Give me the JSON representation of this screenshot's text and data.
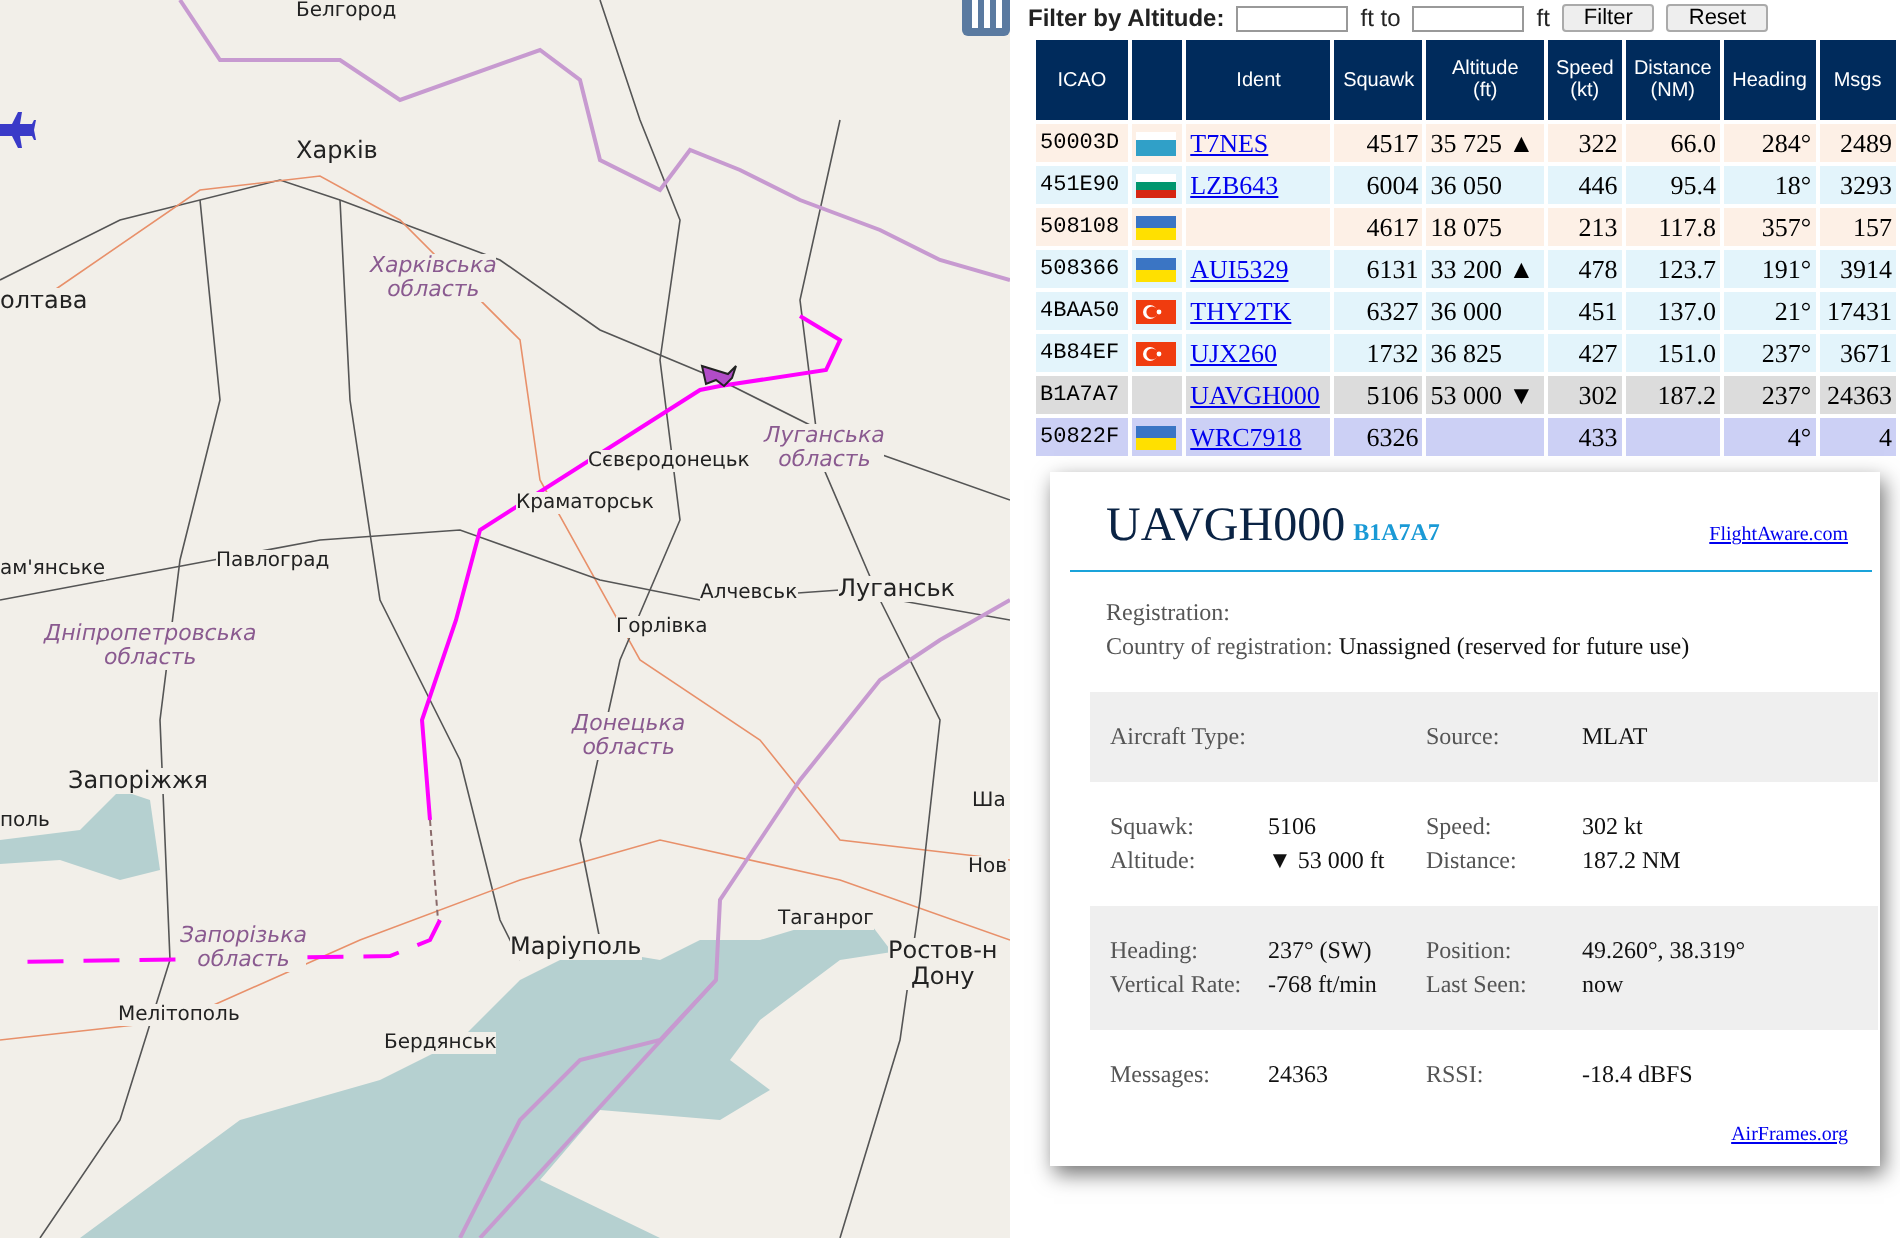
{
  "map": {
    "labels": [
      {
        "text": "Белгород",
        "kind": "city"
      },
      {
        "text": "Харків",
        "kind": "big-city"
      },
      {
        "text": "Харківська\nобласть",
        "kind": "region"
      },
      {
        "text": "олтава",
        "kind": "big-city"
      },
      {
        "text": "Сєвєродонецьк",
        "kind": "city"
      },
      {
        "text": "Луганська\nобласть",
        "kind": "region"
      },
      {
        "text": "Краматорськ",
        "kind": "city"
      },
      {
        "text": "Павлоград",
        "kind": "city"
      },
      {
        "text": "ам'янське",
        "kind": "city"
      },
      {
        "text": "Алчевськ",
        "kind": "city"
      },
      {
        "text": "Луганськ",
        "kind": "big-city"
      },
      {
        "text": "Горлівка",
        "kind": "city"
      },
      {
        "text": "Дніпропетровська\nобласть",
        "kind": "region"
      },
      {
        "text": "Донецька\nобласть",
        "kind": "region"
      },
      {
        "text": "Запоріжжя",
        "kind": "big-city"
      },
      {
        "text": "поль",
        "kind": "city"
      },
      {
        "text": "Ша",
        "kind": "city"
      },
      {
        "text": "Нов",
        "kind": "city"
      },
      {
        "text": "Таганрог",
        "kind": "city"
      },
      {
        "text": "Маріуполь",
        "kind": "big-city"
      },
      {
        "text": "Ростов-н\nДону",
        "kind": "big-city"
      },
      {
        "text": "Запорізька\nобласть",
        "kind": "region"
      },
      {
        "text": "Мелітополь",
        "kind": "city"
      },
      {
        "text": "Бердянськ",
        "kind": "city"
      }
    ]
  },
  "filter": {
    "label": "Filter by Altitude:",
    "to": "ft to",
    "unit": "ft",
    "buttons": [
      "Filter",
      "Reset"
    ]
  },
  "table": {
    "columns": [
      "ICAO",
      "",
      "Ident",
      "Squawk",
      "Altitude\n(ft)",
      "Speed\n(kt)",
      "Distance\n(NM)",
      "Heading",
      "Msgs"
    ],
    "rows": [
      {
        "icao": "50003D",
        "kind": "white-blue",
        "ident": "T7NES",
        "squawk": "4517",
        "altitude": "35 725 ▲",
        "speed": "322",
        "distance": "66.0",
        "heading": "284°",
        "msgs": "2489",
        "color": "#fdf0e6"
      },
      {
        "icao": "451E90",
        "kind": "bg",
        "ident": "LZB643",
        "squawk": "6004",
        "altitude": "36 050",
        "speed": "446",
        "distance": "95.4",
        "heading": "18°",
        "msgs": "3293",
        "color": "#e3f4fb"
      },
      {
        "icao": "508108",
        "kind": "ua",
        "squawk": "4617",
        "altitude": "18 075",
        "speed": "213",
        "distance": "117.8",
        "heading": "357°",
        "msgs": "157",
        "color": "#fdf0e6"
      },
      {
        "icao": "508366",
        "kind": "ua",
        "ident": "AUI5329",
        "squawk": "6131",
        "altitude": "33 200 ▲",
        "speed": "478",
        "distance": "123.7",
        "heading": "191°",
        "msgs": "3914",
        "color": "#e3f4fb"
      },
      {
        "icao": "4BAA50",
        "kind": "tr",
        "ident": "THY2TK",
        "squawk": "6327",
        "altitude": "36 000",
        "speed": "451",
        "distance": "137.0",
        "heading": "21°",
        "msgs": "17431",
        "color": "#e3f4fb"
      },
      {
        "icao": "4B84EF",
        "kind": "tr",
        "ident": "UJX260",
        "squawk": "1732",
        "altitude": "36 825",
        "speed": "427",
        "distance": "151.0",
        "heading": "237°",
        "msgs": "3671",
        "color": "#e3f4fb"
      },
      {
        "icao": "B1A7A7",
        "kind": "no-flag",
        "ident": "UAVGH000",
        "squawk": "5106",
        "altitude": "53 000 ▼",
        "speed": "302",
        "distance": "187.2",
        "heading": "237°",
        "msgs": "24363",
        "color": "#dcdcdc"
      },
      {
        "icao": "50822F",
        "kind": "ua",
        "ident": "WRC7918",
        "squawk": "6326",
        "speed": "433",
        "heading": "4°",
        "msgs": "4",
        "color": "#ccd0f5"
      }
    ]
  },
  "popup": {
    "ident": "UAVGH000",
    "icao": "B1A7A7",
    "link": "FlightAware.com",
    "registration": [
      {
        "label": "Registration:"
      },
      {
        "label": "Country of registration:",
        "value": "Unassigned (reserved for future use)"
      }
    ],
    "sections": [
      {
        "shaded": true,
        "rows": [
          [
            {
              "label": "Aircraft Type:"
            },
            {
              "label": "Source:",
              "value": "MLAT"
            }
          ]
        ]
      },
      {
        "shaded": false,
        "rows": [
          [
            {
              "label": "Squawk:",
              "value": "5106"
            },
            {
              "label": "Speed:",
              "value": "302 kt"
            }
          ],
          [
            {
              "label": "Altitude:",
              "value": "▼ 53 000 ft"
            },
            {
              "label": "Distance:",
              "value": "187.2 NM"
            }
          ]
        ]
      },
      {
        "shaded": true,
        "rows": [
          [
            {
              "label": "Heading:",
              "value": "237° (SW)"
            },
            {
              "label": "Position:",
              "value": "49.260°, 38.319°"
            }
          ],
          [
            {
              "label": "Vertical Rate:",
              "value": "-768 ft/min"
            },
            {
              "label": "Last Seen:",
              "value": "now"
            }
          ]
        ]
      },
      {
        "shaded": false,
        "rows": [
          [
            {
              "label": "Messages:",
              "value": "24363"
            },
            {
              "label": "RSSI:",
              "value": "-18.4 dBFS"
            }
          ]
        ]
      }
    ],
    "footer_link": "AirFrames.org"
  }
}
